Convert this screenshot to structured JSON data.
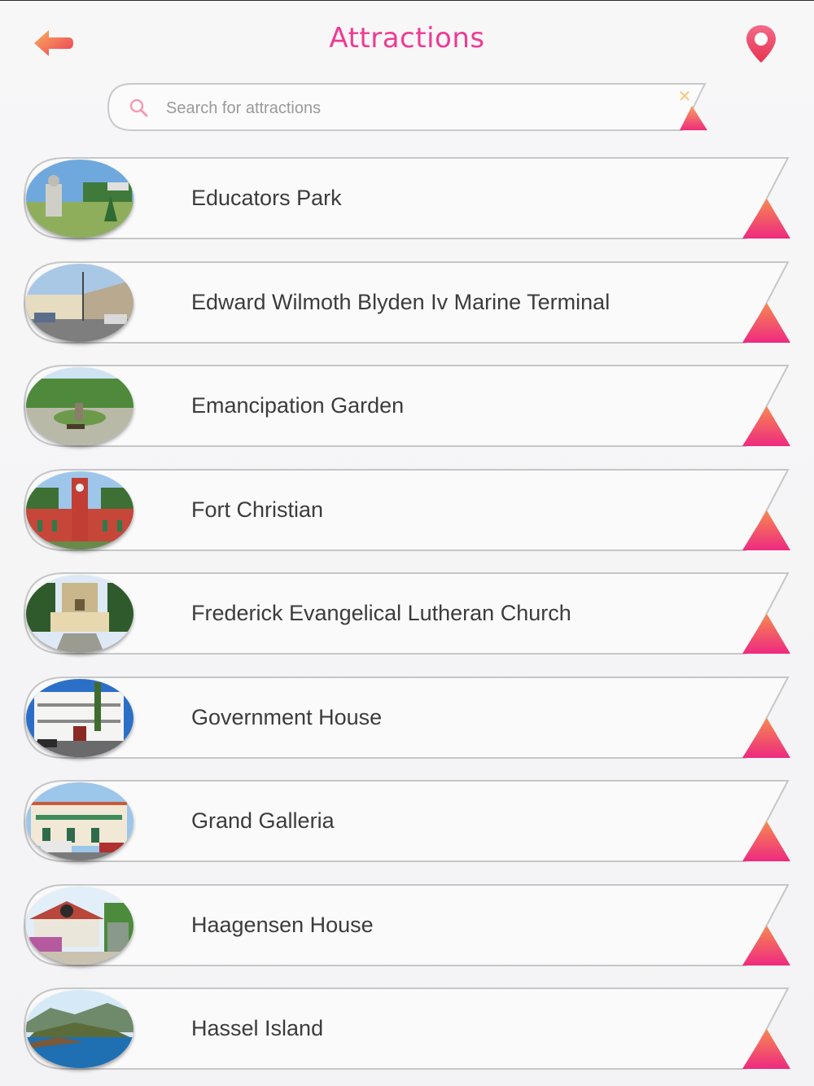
{
  "header": {
    "title": "Attractions",
    "back_icon": "arrow-left-icon",
    "map_icon": "map-pin-icon",
    "accent_color": "#f03a93"
  },
  "search": {
    "placeholder": "Search for attractions",
    "value": ""
  },
  "attractions": [
    {
      "name": "Educators Park",
      "thumb": "park"
    },
    {
      "name": "Edward Wilmoth Blyden Iv Marine Terminal",
      "thumb": "street"
    },
    {
      "name": "Emancipation Garden",
      "thumb": "garden"
    },
    {
      "name": "Fort Christian",
      "thumb": "fort"
    },
    {
      "name": "Frederick Evangelical Lutheran Church",
      "thumb": "church"
    },
    {
      "name": "Government House",
      "thumb": "mansion"
    },
    {
      "name": "Grand Galleria",
      "thumb": "galleria"
    },
    {
      "name": "Haagensen House",
      "thumb": "house"
    },
    {
      "name": "Hassel Island",
      "thumb": "island"
    }
  ]
}
